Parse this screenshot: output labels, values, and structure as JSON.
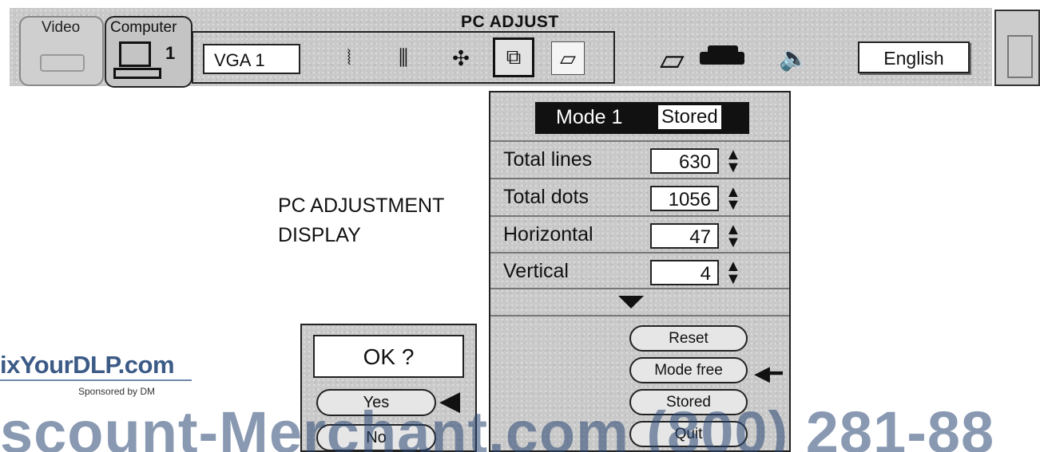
{
  "toolbar": {
    "title": "PC ADJUST",
    "tabs": {
      "video_label": "Video",
      "computer_label": "Computer",
      "computer_number": "1"
    },
    "input_source": "VGA 1",
    "language": "English",
    "icons": [
      "wave-icon",
      "bars-icon",
      "move-icon",
      "pc-adjust-icon",
      "screen-icon",
      "keystone-icon",
      "projector-icon",
      "speaker-icon"
    ]
  },
  "caption": {
    "line1": "PC ADJUSTMENT",
    "line2": "DISPLAY"
  },
  "panel": {
    "mode": "Mode 1",
    "mode_status": "Stored",
    "rows": [
      {
        "label": "Total lines",
        "value": "630"
      },
      {
        "label": "Total dots",
        "value": "1056"
      },
      {
        "label": "Horizontal",
        "value": "47"
      },
      {
        "label": "Vertical",
        "value": "4"
      }
    ],
    "buttons": {
      "reset": "Reset",
      "mode_free": "Mode free",
      "stored": "Stored",
      "quit": "Quit"
    }
  },
  "dialog": {
    "question": "OK ?",
    "yes": "Yes",
    "no": "No"
  },
  "watermark": {
    "brand": "ixYourDLP.com",
    "sponsor": "Sponsored by DM",
    "big_text": "scount-Merchant.com (800) 281-88"
  },
  "colors": {
    "panel_gray": "#c9c9c9",
    "watermark_blue": "#3b5a86"
  }
}
